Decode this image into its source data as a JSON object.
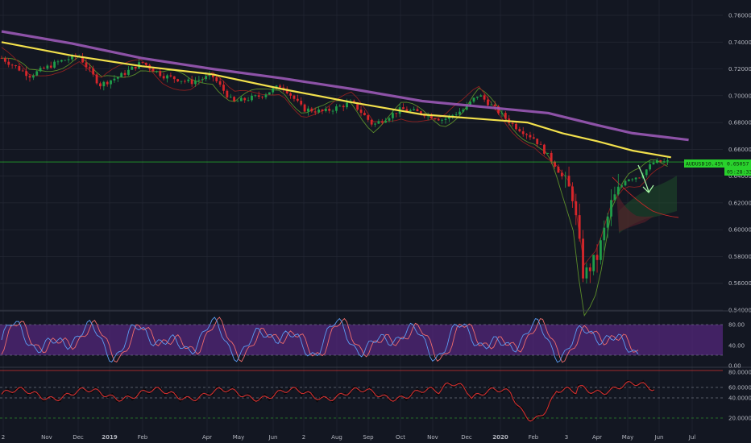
{
  "symbol": {
    "label": "AUDUSD",
    "change": "-10.45%",
    "price": "0.65057",
    "countdown": "05:28:33"
  },
  "colors": {
    "background": "#131722",
    "grid": "#242834",
    "up": "#26a69a",
    "down": "#ef5350",
    "candle_up": "#1f9e4a",
    "candle_down": "#d7262b",
    "ma_fast": "#f2e04c",
    "ma_slow": "#9b59b6",
    "price_line": "#29d12c",
    "stoch_band": "#6a2c9a",
    "rsi_line": "#d32f2f"
  },
  "price_axis": [
    "0.76000",
    "0.74000",
    "0.72000",
    "0.70000",
    "0.68000",
    "0.66000",
    "0.64000",
    "0.62000",
    "0.60000",
    "0.58000",
    "0.56000",
    "0.54000"
  ],
  "stoch_axis": [
    "80.00",
    "40.00",
    "0.00"
  ],
  "rsi_axis": [
    "80.0000",
    "60.0000",
    "40.0000",
    "20.0000"
  ],
  "time_axis": [
    "2",
    "Nov",
    "Dec",
    "2019",
    "Feb",
    "Apr",
    "May",
    "Jun",
    "2",
    "Aug",
    "Sep",
    "Oct",
    "Nov",
    "Dec",
    "2020",
    "Feb",
    "3",
    "Apr",
    "May",
    "Jun",
    "Jul"
  ],
  "time_axis_bold": [
    "2019",
    "2020"
  ],
  "chart_data": {
    "type": "candlestick",
    "instrument": "AUDUSD",
    "ylim": [
      0.54,
      0.76
    ],
    "last_price": 0.65057,
    "price_path": [
      [
        0,
        0.728
      ],
      [
        0.04,
        0.715
      ],
      [
        0.08,
        0.725
      ],
      [
        0.11,
        0.73
      ],
      [
        0.14,
        0.708
      ],
      [
        0.17,
        0.715
      ],
      [
        0.2,
        0.725
      ],
      [
        0.23,
        0.715
      ],
      [
        0.27,
        0.71
      ],
      [
        0.3,
        0.715
      ],
      [
        0.33,
        0.695
      ],
      [
        0.37,
        0.7
      ],
      [
        0.4,
        0.708
      ],
      [
        0.43,
        0.69
      ],
      [
        0.46,
        0.688
      ],
      [
        0.5,
        0.695
      ],
      [
        0.53,
        0.678
      ],
      [
        0.57,
        0.69
      ],
      [
        0.6,
        0.687
      ],
      [
        0.63,
        0.682
      ],
      [
        0.66,
        0.69
      ],
      [
        0.68,
        0.701
      ],
      [
        0.7,
        0.692
      ],
      [
        0.73,
        0.678
      ],
      [
        0.76,
        0.668
      ],
      [
        0.79,
        0.648
      ],
      [
        0.815,
        0.625
      ],
      [
        0.83,
        0.565
      ],
      [
        0.85,
        0.58
      ],
      [
        0.87,
        0.62
      ],
      [
        0.89,
        0.638
      ],
      [
        0.91,
        0.64
      ],
      [
        0.93,
        0.65
      ],
      [
        0.95,
        0.6506
      ]
    ],
    "ma_fast_path": [
      [
        0,
        0.74
      ],
      [
        0.1,
        0.73
      ],
      [
        0.2,
        0.722
      ],
      [
        0.3,
        0.716
      ],
      [
        0.4,
        0.705
      ],
      [
        0.5,
        0.695
      ],
      [
        0.6,
        0.686
      ],
      [
        0.7,
        0.682
      ],
      [
        0.75,
        0.68
      ],
      [
        0.8,
        0.672
      ],
      [
        0.85,
        0.666
      ],
      [
        0.9,
        0.659
      ],
      [
        0.955,
        0.654
      ]
    ],
    "ma_slow_path": [
      [
        0,
        0.748
      ],
      [
        0.1,
        0.739
      ],
      [
        0.2,
        0.728
      ],
      [
        0.3,
        0.72
      ],
      [
        0.4,
        0.713
      ],
      [
        0.5,
        0.705
      ],
      [
        0.6,
        0.696
      ],
      [
        0.7,
        0.691
      ],
      [
        0.78,
        0.687
      ],
      [
        0.85,
        0.678
      ],
      [
        0.9,
        0.672
      ],
      [
        0.98,
        0.667
      ]
    ],
    "stoch_levels": [
      80,
      20
    ],
    "rsi_levels": [
      60,
      40,
      20
    ]
  }
}
